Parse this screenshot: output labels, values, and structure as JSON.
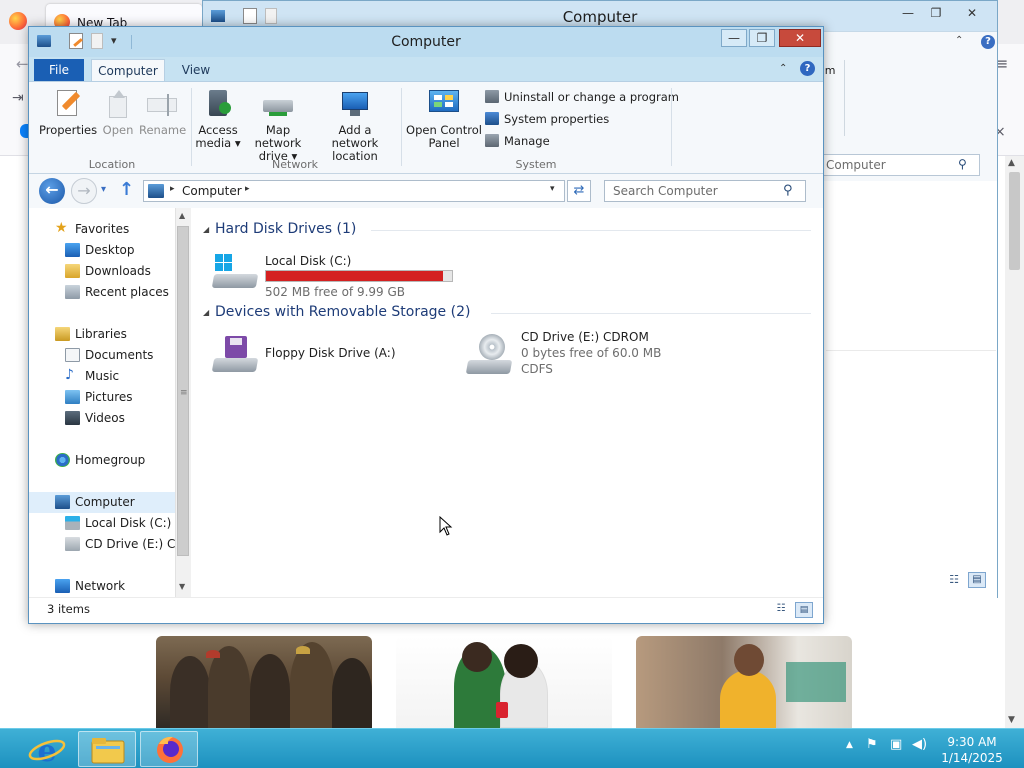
{
  "firefox": {
    "tab_title": "New Tab",
    "back_glyph": "←",
    "signin_glyph": "⇥",
    "menu_glyph": "≡",
    "close_glyph": "×",
    "scroll_up": "▲",
    "scroll_down": "▼",
    "accent": "#0a84ff"
  },
  "back_window": {
    "title": "Computer",
    "min_glyph": "—",
    "max_glyph": "❐",
    "close_glyph": "✕",
    "ribbon_collapse": "⌃",
    "help_glyph": "?",
    "ribbon_fragment": "am",
    "search_placeholder": "Computer",
    "search_icon": "⚲",
    "view_details_glyph": "☷",
    "view_tiles_glyph": "▤"
  },
  "window": {
    "title": "Computer",
    "min_glyph": "—",
    "max_glyph": "❐",
    "close_glyph": "✕",
    "qat_dropdown": "▾"
  },
  "ribbon": {
    "tabs": {
      "file": "File",
      "computer": "Computer",
      "view": "View"
    },
    "collapse_glyph": "⌃",
    "help_glyph": "?",
    "location": {
      "label": "Location",
      "properties": "Properties",
      "open": "Open",
      "rename": "Rename"
    },
    "network": {
      "label": "Network",
      "access_media_1": "Access",
      "access_media_2": "media ▾",
      "map_drive_1": "Map network",
      "map_drive_2": "drive ▾",
      "add_location_1": "Add a network",
      "add_location_2": "location"
    },
    "system": {
      "label": "System",
      "control_panel_1": "Open Control",
      "control_panel_2": "Panel",
      "uninstall": "Uninstall or change a program",
      "system_properties": "System properties",
      "manage": "Manage"
    }
  },
  "address": {
    "back_glyph": "←",
    "forward_glyph": "→",
    "recent_glyph": "▾",
    "up_glyph": "↑",
    "sep_glyph": "▸",
    "path": "Computer",
    "dropdown_glyph": "▾",
    "refresh_glyph": "⇄",
    "search_placeholder": "Search Computer",
    "search_icon": "⚲"
  },
  "nav": {
    "favorites": "Favorites",
    "desktop": "Desktop",
    "downloads": "Downloads",
    "recent_places": "Recent places",
    "libraries": "Libraries",
    "documents": "Documents",
    "music": "Music",
    "pictures": "Pictures",
    "videos": "Videos",
    "homegroup": "Homegroup",
    "computer": "Computer",
    "local_disk": "Local Disk (C:)",
    "cd_drive": "CD Drive (E:) CDFS",
    "network": "Network",
    "scroll_up": "▲",
    "scroll_down": "▼",
    "grip": "≡"
  },
  "content": {
    "expand_glyph": "◢",
    "hdd_group": "Hard Disk Drives (1)",
    "removable_group": "Devices with Removable Storage (2)",
    "local_disk": {
      "name": "Local Disk (C:)",
      "free": "502 MB free of 9.99 GB",
      "used_fraction": 0.951,
      "bar_color": "#d42020"
    },
    "floppy": {
      "name": "Floppy Disk Drive (A:)"
    },
    "cd": {
      "name": "CD Drive (E:) CDROM",
      "free": "0 bytes free of 60.0 MB",
      "fs": "CDFS"
    }
  },
  "status": {
    "items": "3 items",
    "details_glyph": "☷",
    "tiles_glyph": "▤"
  },
  "taskbar": {
    "time": "9:30 AM",
    "date": "1/14/2025",
    "tray_up": "▲",
    "tray_flag": "⚑",
    "tray_network": "▣",
    "tray_volume": "◀)"
  }
}
